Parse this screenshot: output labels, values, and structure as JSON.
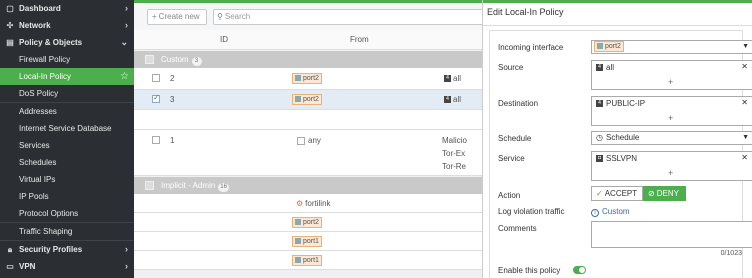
{
  "sidebar": {
    "items": [
      {
        "label": "Dashboard",
        "icon": "dashboard-icon",
        "chevron": "›"
      },
      {
        "label": "Network",
        "icon": "network-icon",
        "chevron": "›"
      },
      {
        "label": "Policy & Objects",
        "icon": "policy-icon",
        "chevron": "⌄"
      },
      {
        "label": "Firewall Policy"
      },
      {
        "label": "Local-In Policy",
        "active": true
      },
      {
        "label": "DoS Policy"
      },
      {
        "label": "Addresses"
      },
      {
        "label": "Internet Service Database"
      },
      {
        "label": "Services"
      },
      {
        "label": "Schedules"
      },
      {
        "label": "Virtual IPs"
      },
      {
        "label": "IP Pools"
      },
      {
        "label": "Protocol Options"
      },
      {
        "label": "Traffic Shaping"
      },
      {
        "label": "Security Profiles",
        "icon": "lock-icon",
        "chevron": "›"
      },
      {
        "label": "VPN",
        "icon": "vpn-icon",
        "chevron": "›"
      }
    ]
  },
  "toolbar": {
    "create_label": "Create new",
    "search_placeholder": "Search"
  },
  "table": {
    "columns": {
      "id": "ID",
      "from": "From"
    },
    "custom_group": {
      "label": "Custom",
      "count": "3"
    },
    "implicit_group": {
      "label": "Implicit - Admin",
      "count": "16"
    },
    "rows": [
      {
        "id": "2",
        "from": "port2",
        "source": "all"
      },
      {
        "id": "3",
        "from": "port2",
        "source": "all",
        "selected": true
      },
      {
        "id": "1",
        "from": "any",
        "source_lines": [
          "Malicio",
          "Tor-Ex",
          "Tor-Re"
        ]
      }
    ],
    "implicit_rows": [
      "fortilink",
      "port2",
      "port1",
      "port1"
    ]
  },
  "panel": {
    "title": "Edit Local-In Policy",
    "incoming_interface": {
      "label": "Incoming interface",
      "value": "port2"
    },
    "source": {
      "label": "Source",
      "value": "all"
    },
    "destination": {
      "label": "Destination",
      "value": "PUBLIC-IP"
    },
    "schedule": {
      "label": "Schedule",
      "value": "Schedule"
    },
    "service": {
      "label": "Service",
      "value": "SSLVPN"
    },
    "action": {
      "label": "Action",
      "accept": "ACCEPT",
      "deny": "DENY",
      "selected": "DENY"
    },
    "log": {
      "label": "Log violation traffic",
      "value": "Custom"
    },
    "comments": {
      "label": "Comments",
      "counter": "0/1023"
    },
    "enable": {
      "label": "Enable this policy",
      "enabled": true
    }
  },
  "colors": {
    "accent": "#4cae4c",
    "sidebar_bg": "#2b2f33",
    "port_tag_bg": "#fbe7d3",
    "port_tag_border": "#e8b37b"
  }
}
